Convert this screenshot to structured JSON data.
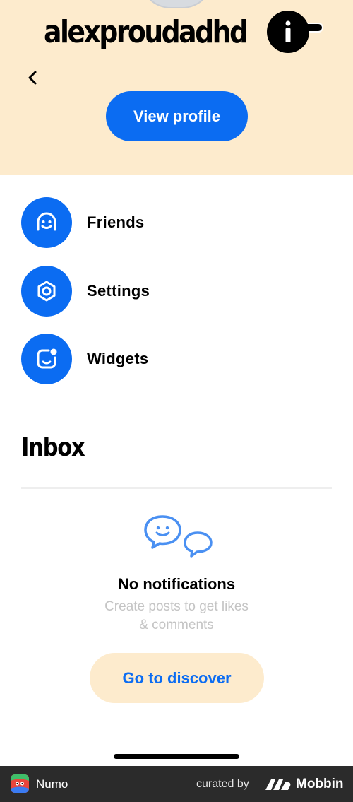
{
  "header": {
    "username": "alexproudadhd",
    "info_icon": "info-icon",
    "back_icon": "chevron-left-icon",
    "view_profile_label": "View profile",
    "background_color": "#fdebcd"
  },
  "menu": {
    "items": [
      {
        "label": "Friends",
        "icon": "smiley-face-icon"
      },
      {
        "label": "Settings",
        "icon": "hexagon-nut-icon"
      },
      {
        "label": "Widgets",
        "icon": "widget-face-icon"
      }
    ]
  },
  "inbox": {
    "title": "Inbox",
    "empty_icon": "chat-bubbles-icon",
    "empty_title": "No notifications",
    "empty_subtitle": "Create posts to get likes & comments",
    "cta_label": "Go to discover"
  },
  "footer": {
    "app_name": "Numo",
    "curated_by": "curated by",
    "brand": "Mobbin"
  },
  "colors": {
    "accent": "#0b6cf2",
    "cream": "#fdebcd",
    "muted_text": "#c4c4c4",
    "footer_bg": "#2b2b2b"
  }
}
